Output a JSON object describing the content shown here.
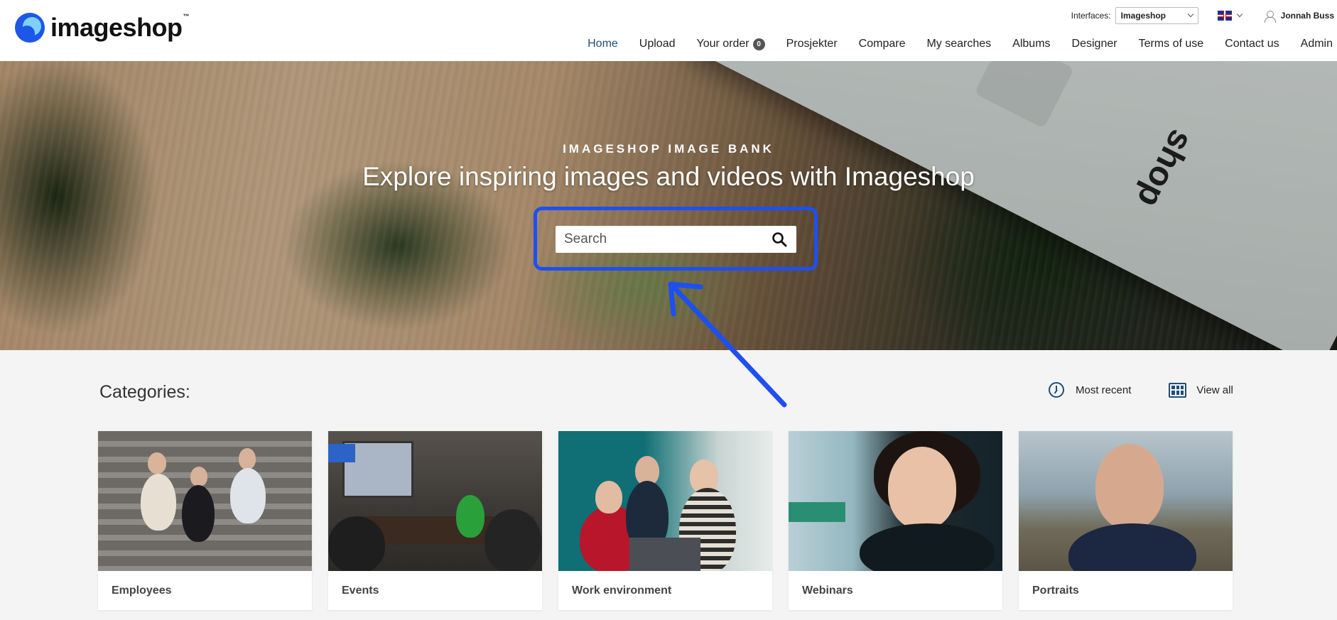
{
  "brand": {
    "name": "imageshop",
    "tm": "™"
  },
  "topbar": {
    "interfaces_label": "Interfaces:",
    "interface_selected": "Imageshop",
    "user_name": "Jonnah Buss"
  },
  "nav": {
    "items": [
      {
        "label": "Home",
        "active": true
      },
      {
        "label": "Upload"
      },
      {
        "label": "Your order",
        "badge": "0"
      },
      {
        "label": "Prosjekter"
      },
      {
        "label": "Compare"
      },
      {
        "label": "My searches"
      },
      {
        "label": "Albums"
      },
      {
        "label": "Designer"
      },
      {
        "label": "Terms of use"
      },
      {
        "label": "Contact us"
      },
      {
        "label": "Admin"
      }
    ]
  },
  "hero": {
    "kicker": "IMAGESHOP IMAGE BANK",
    "headline": "Explore inspiring images and videos with Imageshop",
    "search_placeholder": "Search",
    "box_word": "shop"
  },
  "categories": {
    "title": "Categories:",
    "most_recent": "Most recent",
    "view_all": "View all",
    "cards": [
      {
        "label": "Employees"
      },
      {
        "label": "Events"
      },
      {
        "label": "Work environment"
      },
      {
        "label": "Webinars"
      },
      {
        "label": "Portraits"
      }
    ]
  },
  "colors": {
    "accent": "#1f4e78",
    "highlight": "#1e4ff0",
    "background": "#f4f4f4"
  }
}
